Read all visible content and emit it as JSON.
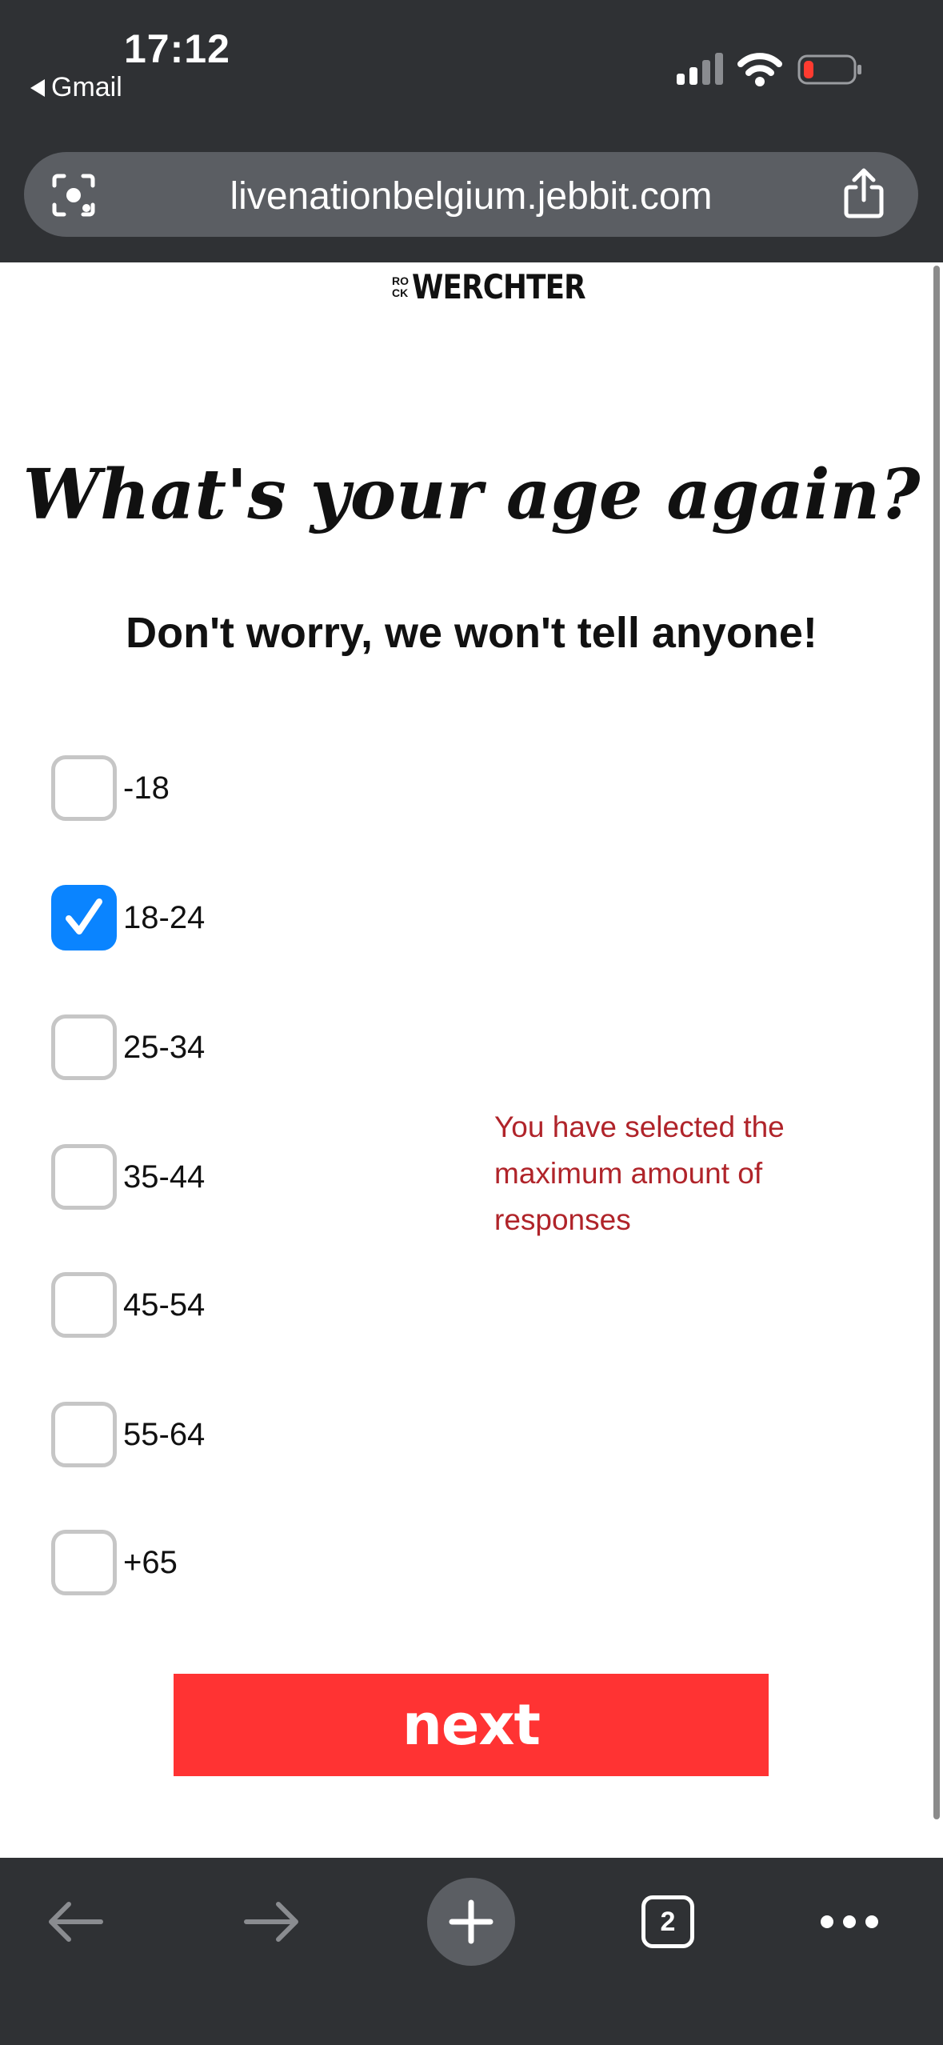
{
  "status_bar": {
    "time": "17:12",
    "back_app": "Gmail",
    "icons": [
      "cellular-signal-icon",
      "wifi-icon",
      "battery-low-icon"
    ],
    "battery_color": "#ff3b30"
  },
  "url_bar": {
    "url": "livenationbelgium.jebbit.com",
    "left_icon": "lens-icon",
    "right_icon": "share-icon"
  },
  "page": {
    "logo_small_top": "RO",
    "logo_small_bottom": "CK",
    "logo_main": "WERCHTER",
    "title": "What's your age again?",
    "subtitle": "Don't worry, we won't tell anyone!",
    "options": [
      {
        "label": "-18",
        "checked": false
      },
      {
        "label": "18-24",
        "checked": true
      },
      {
        "label": "25-34",
        "checked": false
      },
      {
        "label": "35-44",
        "checked": false
      },
      {
        "label": "45-54",
        "checked": false
      },
      {
        "label": "55-64",
        "checked": false
      },
      {
        "label": "+65",
        "checked": false
      }
    ],
    "error_message": "You have selected the maximum amount of responses",
    "next_label": "next",
    "colors": {
      "checkbox_selected": "#0a84ff",
      "error": "#b0242a",
      "next_button": "#ff3333"
    }
  },
  "bottom_toolbar": {
    "tab_count": "2",
    "icons": [
      "back-arrow-icon",
      "forward-arrow-icon",
      "plus-icon",
      "tabs-icon",
      "more-icon"
    ]
  }
}
